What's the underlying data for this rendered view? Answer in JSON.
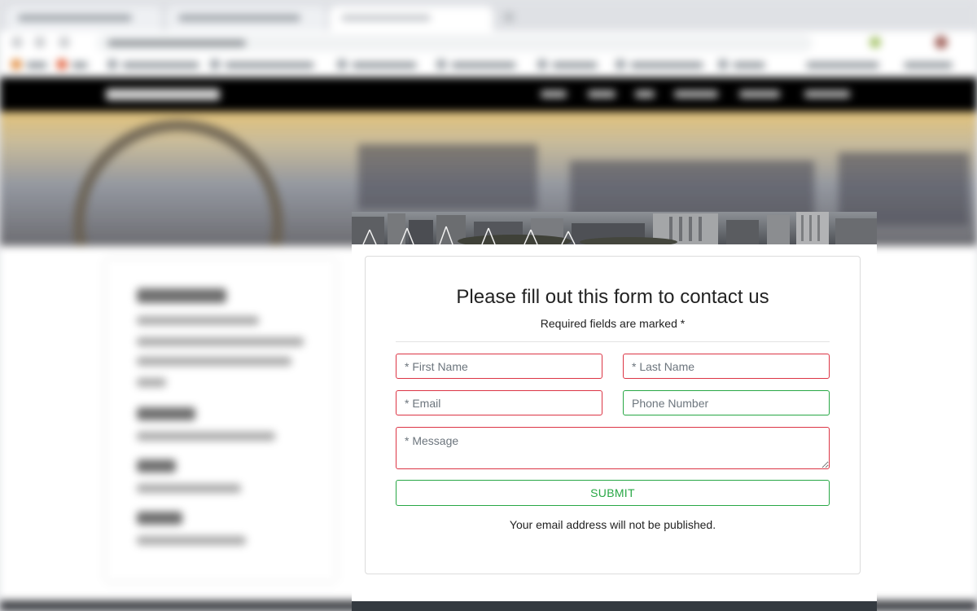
{
  "form": {
    "title": "Please fill out this form to contact us",
    "subtitle": "Required fields are marked *",
    "first_name_placeholder": "* First Name",
    "last_name_placeholder": "* Last Name",
    "email_placeholder": "* Email",
    "phone_placeholder": "Phone Number",
    "message_placeholder": "* Message",
    "submit_label": "SUBMIT",
    "note": "Your email address will not be published."
  },
  "colors": {
    "required_border": "#dc3545",
    "valid_border": "#28a745",
    "nav_background": "#000000"
  }
}
